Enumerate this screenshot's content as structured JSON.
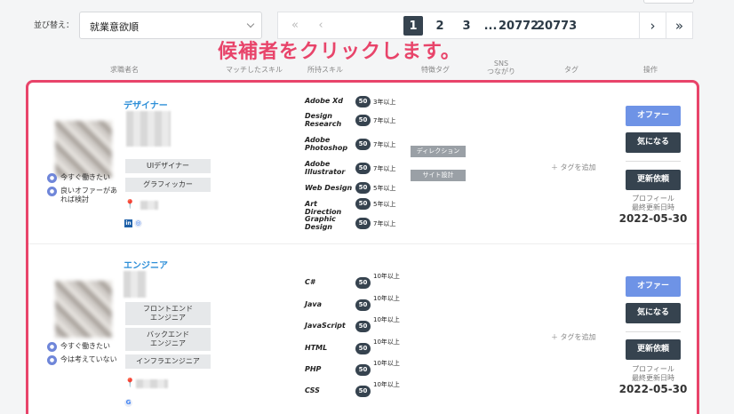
{
  "toolbar": {
    "sort_label": "並び替え：",
    "sort_value": "就業意欲順"
  },
  "pagination": {
    "first": "«",
    "prev": "‹",
    "pages": [
      "1",
      "2",
      "3"
    ],
    "ellipsis": "...",
    "last_pages": [
      "20772",
      "20773"
    ],
    "next": "›",
    "last": "»",
    "current": "1"
  },
  "banner": "候補者をクリックします。",
  "columns": {
    "candidate": "求職者名",
    "matched_skills": "マッチしたスキル",
    "owned_skills": "所持スキル",
    "feature_tags": "特徴タグ",
    "sns": "SNS\nつながり",
    "tags": "タグ",
    "actions": "操作"
  },
  "candidates": [
    {
      "role": "デザイナー",
      "status1": "今すぐ働きたい",
      "status2": "良いオファーがあれば検討",
      "skill_tags": [
        "UIデザイナー",
        "グラフィッカー"
      ],
      "skills": [
        {
          "name": "Adobe Xd",
          "badge": "50",
          "years": "3年以上"
        },
        {
          "name": "Design Research",
          "badge": "50",
          "years": "7年以上"
        },
        {
          "name": "Adobe Photoshop",
          "badge": "50",
          "years": "7年以上"
        },
        {
          "name": "Adobe Illustrator",
          "badge": "50",
          "years": "7年以上"
        },
        {
          "name": "Web Design",
          "badge": "50",
          "years": "5年以上"
        },
        {
          "name": "Art Direction",
          "badge": "50",
          "years": "5年以上"
        },
        {
          "name": "Graphic Design",
          "badge": "50",
          "years": "7年以上"
        }
      ],
      "feature_tags": [
        "ディレクション",
        "サイト設計"
      ],
      "add_tag": "＋ タグを追加",
      "offer": "オファー",
      "interested": "気になる",
      "update_request": "更新依頼",
      "updated_label": "プロフィール\n最終更新日時",
      "updated_date": "2022-05-30"
    },
    {
      "role": "エンジニア",
      "status1": "今すぐ働きたい",
      "status2": "今は考えていない",
      "skill_tags": [
        "フロントエンド\nエンジニア",
        "バックエンド\nエンジニア",
        "インフラエンジニア"
      ],
      "skills": [
        {
          "name": "C#",
          "badge": "50",
          "years": "10年以上"
        },
        {
          "name": "Java",
          "badge": "50",
          "years": "10年以上"
        },
        {
          "name": "JavaScript",
          "badge": "50",
          "years": "10年以上"
        },
        {
          "name": "HTML",
          "badge": "50",
          "years": "10年以上"
        },
        {
          "name": "PHP",
          "badge": "50",
          "years": "10年以上"
        },
        {
          "name": "CSS",
          "badge": "50",
          "years": "10年以上"
        }
      ],
      "add_tag": "＋ タグを追加",
      "offer": "オファー",
      "interested": "気になる",
      "update_request": "更新依頼",
      "updated_label": "プロフィール\n最終更新日時",
      "updated_date": "2022-05-30"
    }
  ]
}
